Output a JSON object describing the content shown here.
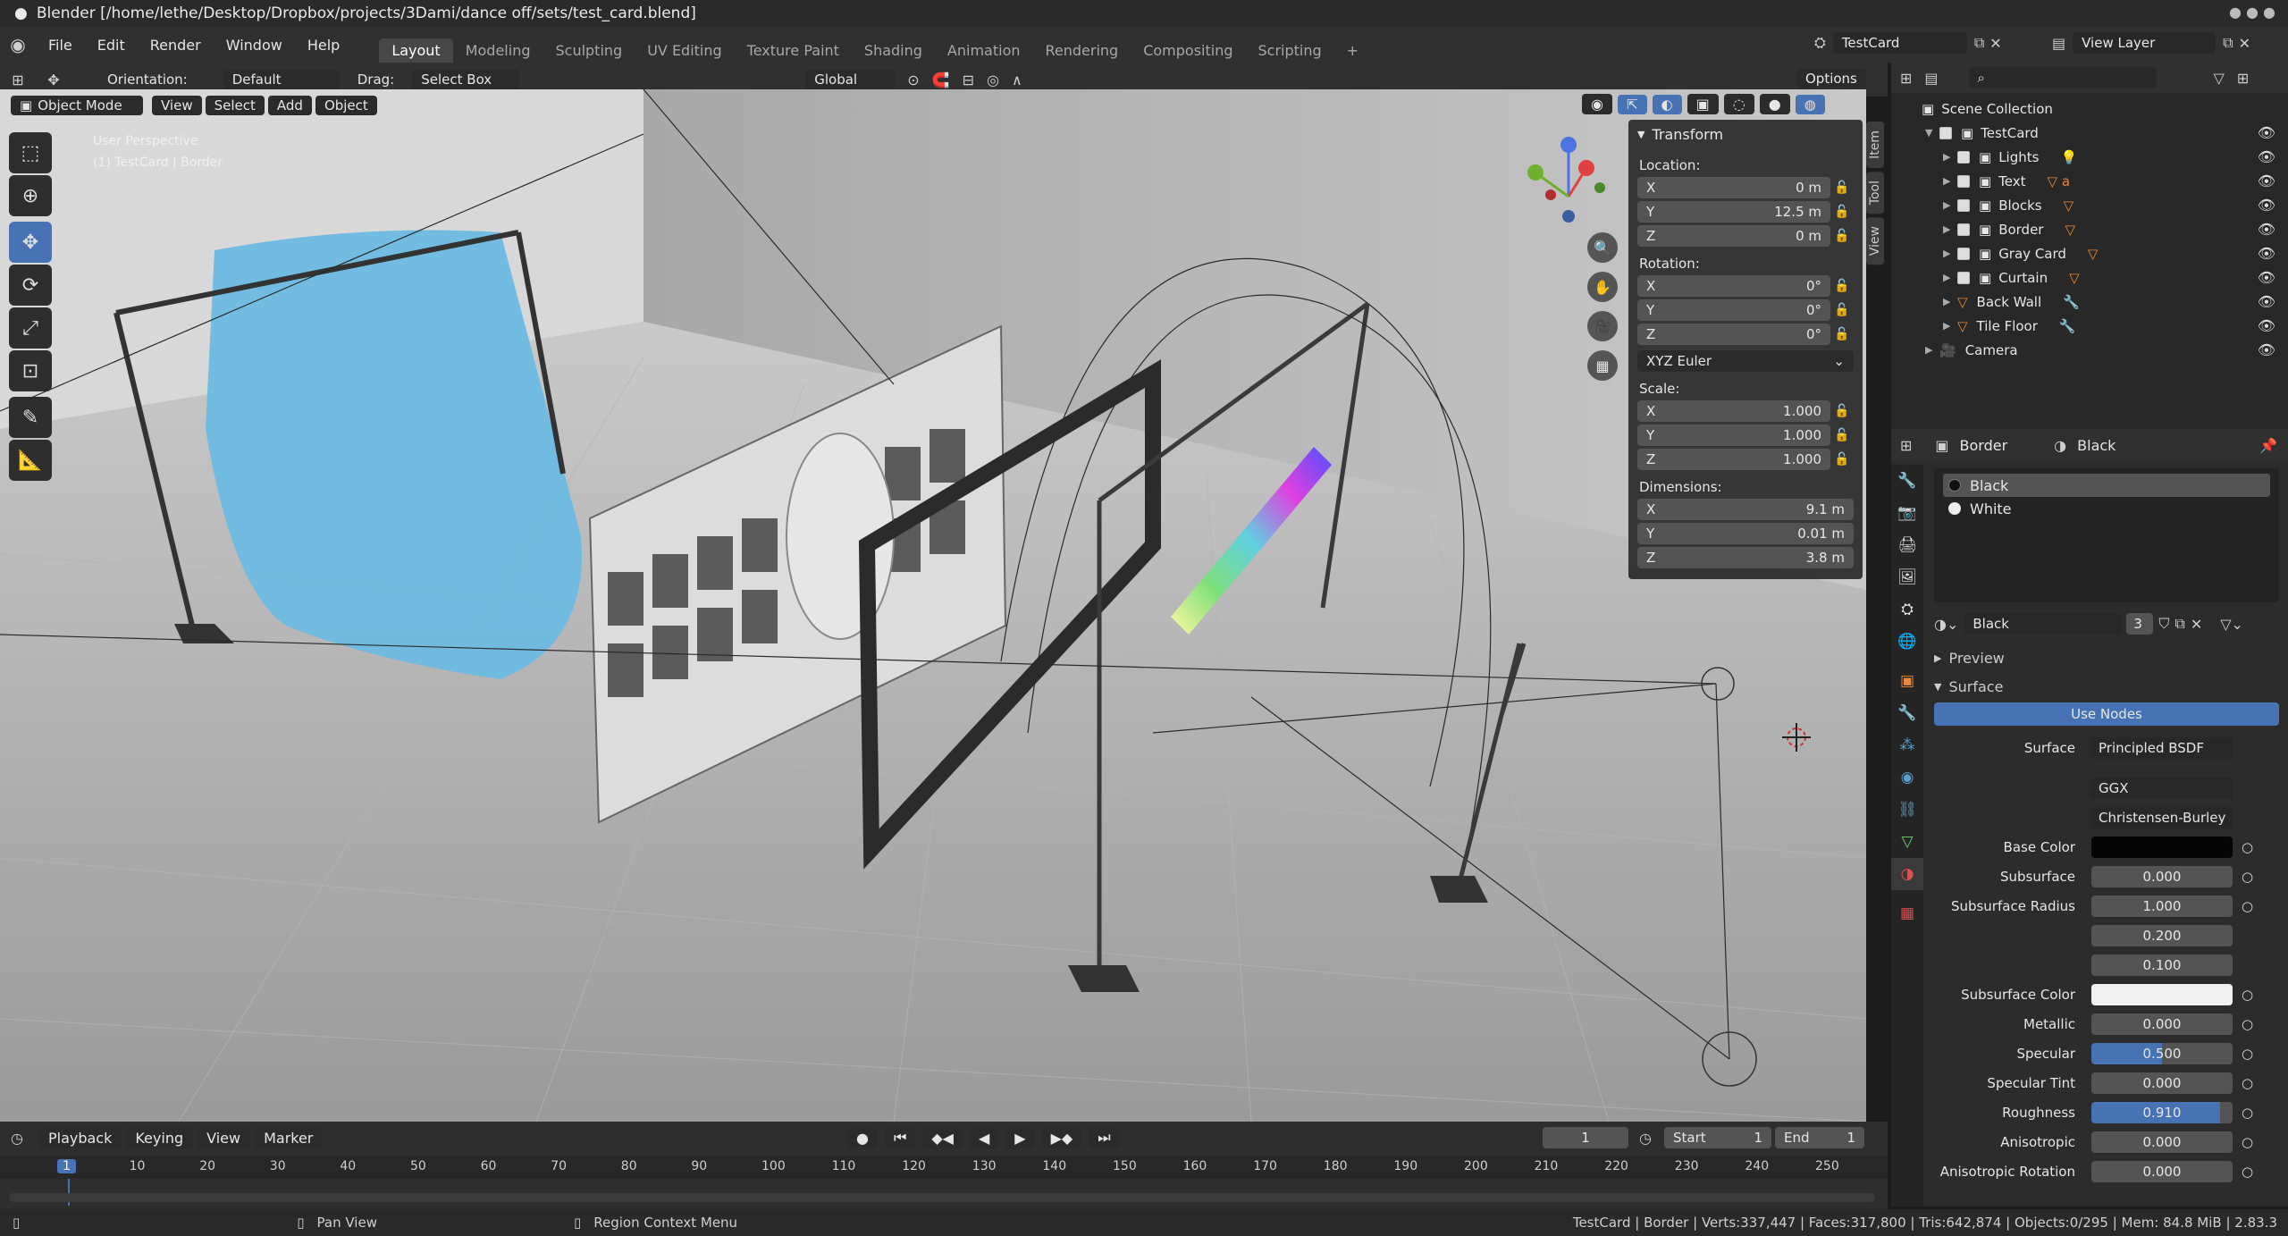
{
  "window": {
    "title": "Blender [/home/lethe/Desktop/Dropbox/projects/3Dami/dance off/sets/test_card.blend]"
  },
  "menu": {
    "items": [
      "File",
      "Edit",
      "Render",
      "Window",
      "Help"
    ]
  },
  "workspaces": [
    "Layout",
    "Modeling",
    "Sculpting",
    "UV Editing",
    "Texture Paint",
    "Shading",
    "Animation",
    "Rendering",
    "Compositing",
    "Scripting"
  ],
  "scene": {
    "name": "TestCard",
    "view_layer": "View Layer"
  },
  "toolheader": {
    "orientation_label": "Orientation:",
    "orientation_value": "Default",
    "drag_label": "Drag:",
    "drag_value": "Select Box",
    "transform_orientation": "Global",
    "options": "Options"
  },
  "viewport": {
    "mode": "Object Mode",
    "menus": [
      "View",
      "Select",
      "Add",
      "Object"
    ],
    "overlay_title": "User Perspective",
    "overlay_sub": "(1) TestCard | Border"
  },
  "npanel": {
    "title": "Transform",
    "location_label": "Location:",
    "location": [
      {
        "axis": "X",
        "value": "0 m"
      },
      {
        "axis": "Y",
        "value": "12.5 m"
      },
      {
        "axis": "Z",
        "value": "0 m"
      }
    ],
    "rotation_label": "Rotation:",
    "rotation": [
      {
        "axis": "X",
        "value": "0°"
      },
      {
        "axis": "Y",
        "value": "0°"
      },
      {
        "axis": "Z",
        "value": "0°"
      }
    ],
    "rotation_mode": "XYZ Euler",
    "scale_label": "Scale:",
    "scale": [
      {
        "axis": "X",
        "value": "1.000"
      },
      {
        "axis": "Y",
        "value": "1.000"
      },
      {
        "axis": "Z",
        "value": "1.000"
      }
    ],
    "dimensions_label": "Dimensions:",
    "dimensions": [
      {
        "axis": "X",
        "value": "9.1 m"
      },
      {
        "axis": "Y",
        "value": "0.01 m"
      },
      {
        "axis": "Z",
        "value": "3.8 m"
      }
    ],
    "tabs": [
      "Item",
      "Tool",
      "View"
    ]
  },
  "outliner": {
    "root": "Scene Collection",
    "collection": "TestCard",
    "items": [
      "Lights",
      "Text",
      "Blocks",
      "Border",
      "Gray Card",
      "Curtain",
      "Back Wall",
      "Tile Floor"
    ],
    "camera": "Camera"
  },
  "properties": {
    "object": "Border",
    "material": "Black",
    "slots": [
      "Black",
      "White"
    ],
    "material_field": "Black",
    "users": "3",
    "preview": "Preview",
    "surface_section": "Surface",
    "use_nodes": "Use Nodes",
    "surface_label": "Surface",
    "surface_value": "Principled BSDF",
    "distribution": "GGX",
    "subsurface_method": "Christensen-Burley",
    "params": [
      {
        "label": "Base Color",
        "value": ""
      },
      {
        "label": "Subsurface",
        "value": "0.000"
      },
      {
        "label": "Subsurface Radius",
        "value": "1.000"
      },
      {
        "label": "",
        "value": "0.200"
      },
      {
        "label": "",
        "value": "0.100"
      },
      {
        "label": "Subsurface Color",
        "value": ""
      },
      {
        "label": "Metallic",
        "value": "0.000"
      },
      {
        "label": "Specular",
        "value": "0.500"
      },
      {
        "label": "Specular Tint",
        "value": "0.000"
      },
      {
        "label": "Roughness",
        "value": "0.910"
      },
      {
        "label": "Anisotropic",
        "value": "0.000"
      },
      {
        "label": "Anisotropic Rotation",
        "value": "0.000"
      }
    ],
    "specular_fraction": 0.5,
    "roughness_fraction": 0.91
  },
  "timeline": {
    "menus": [
      "Playback",
      "Keying",
      "View",
      "Marker"
    ],
    "current_frame": "1",
    "start_label": "Start",
    "start": "1",
    "end_label": "End",
    "end": "1",
    "ticks": [
      "1",
      "10",
      "20",
      "30",
      "40",
      "50",
      "60",
      "70",
      "80",
      "90",
      "100",
      "110",
      "120",
      "130",
      "140",
      "150",
      "160",
      "170",
      "180",
      "190",
      "200",
      "210",
      "220",
      "230",
      "240",
      "250"
    ]
  },
  "status": {
    "left": "Pan View",
    "middle": "Region Context Menu",
    "right": "TestCard | Border | Verts:337,447 | Faces:317,800 | Tris:642,874 | Objects:0/295 | Mem: 84.8 MiB | 2.83.3"
  },
  "colors": {
    "accent": "#4772b3",
    "curtain": "#5fb3d8",
    "outliner_orange": "#e8883a"
  }
}
